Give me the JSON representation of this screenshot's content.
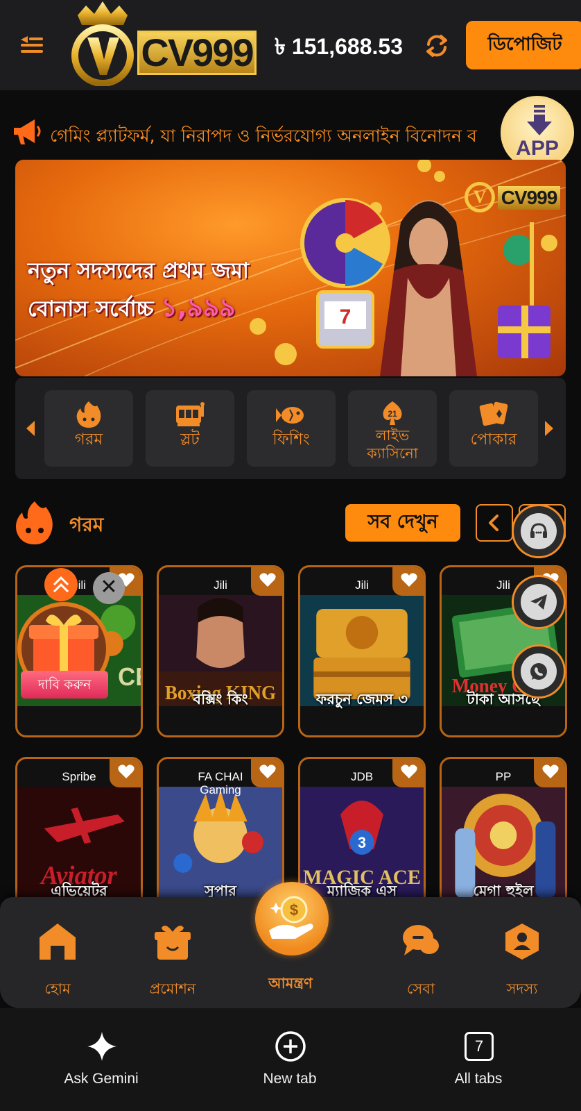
{
  "header": {
    "brand": "CV999",
    "balance": "৳ 151,688.53",
    "deposit_label": "ডিপোজিট"
  },
  "announcement": {
    "text": "গেমিং প্ল্যাটফর্ম, যা নিরাপদ ও নির্ভরযোগ্য অনলাইন বিনোদন ব"
  },
  "app_button": {
    "label": "APP"
  },
  "banner": {
    "line1": "নতুন সদস্যদের প্রথম জমা",
    "line2": "বোনাস সর্বোচ্চ",
    "amount": "১,৯৯৯",
    "logo_text": "CV999"
  },
  "categories": [
    {
      "label": "গরম",
      "icon": "fire-icon"
    },
    {
      "label": "স্লট",
      "icon": "slot-icon"
    },
    {
      "label": "ফিশিং",
      "icon": "fish-icon"
    },
    {
      "label": "লাইভ ক্যাসিনো",
      "icon": "live-casino-icon"
    },
    {
      "label": "পোকার",
      "icon": "cards-icon"
    }
  ],
  "hot_section": {
    "title": "গরম",
    "see_all_label": "সব দেখুন"
  },
  "games": [
    {
      "provider": "Jili",
      "name": "",
      "art": "ace"
    },
    {
      "provider": "Jili",
      "name": "বক্সিং কিং",
      "art": "boxing"
    },
    {
      "provider": "Jili",
      "name": "ফরচুন জেমস ৩",
      "art": "fortune"
    },
    {
      "provider": "Jili",
      "name": "টাকা আসছে",
      "art": "money"
    },
    {
      "provider": "Spribe",
      "name": "এভিয়েটর",
      "art": "aviator"
    },
    {
      "provider": "FA CHAI Gaming",
      "name": "সুপার",
      "art": "super"
    },
    {
      "provider": "JDB",
      "name": "ম্যাজিক এস",
      "art": "magic"
    },
    {
      "provider": "PP",
      "name": "মেগা হুইল",
      "art": "wheel"
    }
  ],
  "claim_popup": {
    "label": "দাবি করুন",
    "close": "✕"
  },
  "bottom_nav": [
    {
      "label": "হোম",
      "icon": "home-icon"
    },
    {
      "label": "প্রমোশন",
      "icon": "gift-icon"
    },
    {
      "label": "আমন্ত্রণ",
      "icon": "invite-icon"
    },
    {
      "label": "সেবা",
      "icon": "chat-icon"
    },
    {
      "label": "সদস্য",
      "icon": "member-icon"
    }
  ],
  "browser": {
    "gemini_label": "Ask Gemini",
    "new_tab_label": "New tab",
    "all_tabs_label": "All tabs",
    "tab_count": "7"
  },
  "colors": {
    "accent": "#ff8b0e",
    "accent_text": "#f28c28",
    "header_bg": "#1d1d1f",
    "page_bg": "#0c0c0c"
  }
}
